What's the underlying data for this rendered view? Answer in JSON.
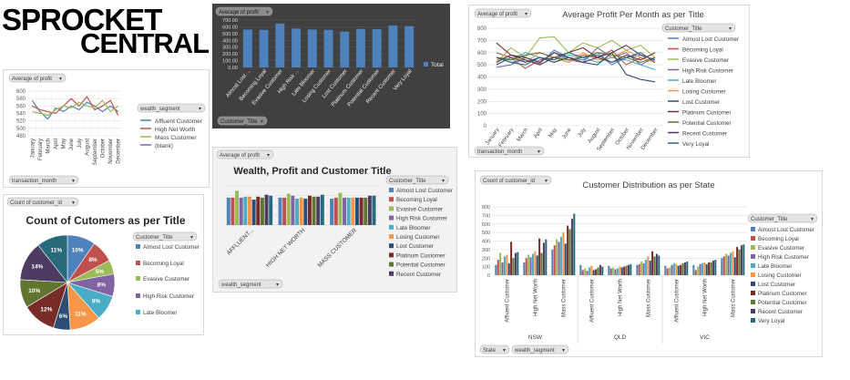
{
  "logo": {
    "line1": "SPROCKET",
    "line2": "CENTRAL"
  },
  "panels": {
    "profit_by_month": {
      "field_button": "Average of profit",
      "row_button": "transaction_month",
      "legend_button": "wealth_segment",
      "chart_data": {
        "type": "line",
        "ylim": [
          480,
          600
        ],
        "yticks": [
          "600",
          "580",
          "560",
          "540",
          "520",
          "500",
          "480"
        ],
        "categories": [
          "January",
          "February",
          "March",
          "April",
          "May",
          "June",
          "July",
          "August",
          "September",
          "October",
          "November",
          "December"
        ],
        "series": [
          {
            "name": "Affluent Customer",
            "color": "#4f81bd",
            "values": [
              575,
              545,
              525,
              555,
              545,
              560,
              550,
              570,
              560,
              545,
              560,
              545
            ]
          },
          {
            "name": "High Net Worth",
            "color": "#c0504d",
            "values": [
              560,
              550,
              545,
              540,
              560,
              580,
              560,
              585,
              550,
              560,
              575,
              535
            ]
          },
          {
            "name": "Mass Customer",
            "color": "#9bbb59",
            "values": [
              545,
              540,
              535,
              550,
              560,
              555,
              570,
              560,
              555,
              575,
              545,
              560
            ]
          },
          {
            "name": "(blank)",
            "color": "#8064a2",
            "values": []
          }
        ]
      }
    },
    "profit_by_title_dark": {
      "field_button": "Average of profit",
      "filter_button": "Customer_Title",
      "chart_data": {
        "type": "bar",
        "ylim": [
          0,
          700
        ],
        "yticks": [
          "700.00",
          "600.00",
          "500.00",
          "400.00",
          "300.00",
          "200.00",
          "100.00",
          "0.00"
        ],
        "categories": [
          "Almost Lost ...",
          "Becoming Loyal",
          "Evasive Customer",
          "High Risk ...",
          "Late Bloomer",
          "Losing Customer",
          "Lost Customer",
          "Platinum Customer",
          "Potential Customer",
          "Recent Customer",
          "Very Loyal"
        ],
        "series": [
          {
            "name": "Total",
            "color": "#4f81bd",
            "values": [
              560,
              555,
              650,
              575,
              560,
              555,
              530,
              570,
              565,
              620,
              610
            ]
          }
        ]
      }
    },
    "avg_profit_month_title": {
      "field_button": "Average of profit",
      "row_button": "transaction_month",
      "legend_button": "Customer_Title",
      "chart_data": {
        "type": "line",
        "title": "Average Profit Per Month as per Title",
        "ylim": [
          0,
          800
        ],
        "yticks": [
          "800",
          "700",
          "600",
          "500",
          "400",
          "300",
          "200",
          "100",
          "0"
        ],
        "categories": [
          "January",
          "February",
          "March",
          "April",
          "May",
          "June",
          "July",
          "August",
          "September",
          "October",
          "November",
          "December"
        ],
        "series": [
          {
            "name": "Almost Lost Customer",
            "color": "#4f81bd",
            "values": [
              560,
              520,
              540,
              510,
              620,
              560,
              540,
              600,
              500,
              560,
              580,
              540
            ]
          },
          {
            "name": "Becoming Loyal",
            "color": "#c0504d",
            "values": [
              600,
              560,
              470,
              540,
              560,
              520,
              580,
              560,
              620,
              500,
              560,
              520
            ]
          },
          {
            "name": "Evasive Customer",
            "color": "#9bbb59",
            "values": [
              520,
              640,
              560,
              720,
              730,
              600,
              680,
              640,
              700,
              620,
              660,
              560
            ]
          },
          {
            "name": "High Risk Customer",
            "color": "#8064a2",
            "values": [
              480,
              500,
              560,
              520,
              600,
              540,
              520,
              640,
              560,
              600,
              500,
              560
            ]
          },
          {
            "name": "Late Bloomer",
            "color": "#4bacc6",
            "values": [
              560,
              540,
              600,
              560,
              520,
              580,
              560,
              520,
              560,
              540,
              500,
              460
            ]
          },
          {
            "name": "Losing Customer",
            "color": "#f79646",
            "values": [
              540,
              580,
              520,
              600,
              560,
              520,
              600,
              540,
              560,
              620,
              560,
              520
            ]
          },
          {
            "name": "Lost Customer",
            "color": "#2c4d75",
            "values": [
              500,
              560,
              520,
              560,
              520,
              560,
              520,
              500,
              600,
              420,
              380,
              360
            ]
          },
          {
            "name": "Platinum Customer",
            "color": "#772c2a",
            "values": [
              680,
              580,
              540,
              500,
              560,
              600,
              640,
              560,
              520,
              580,
              540,
              600
            ]
          },
          {
            "name": "Potential Customer",
            "color": "#5f7530",
            "values": [
              560,
              540,
              580,
              600,
              560,
              540,
              560,
              600,
              580,
              560,
              520,
              560
            ]
          },
          {
            "name": "Recent Customer",
            "color": "#4d3b62",
            "values": [
              520,
              580,
              560,
              520,
              600,
              560,
              520,
              560,
              600,
              660,
              580,
              540
            ]
          },
          {
            "name": "Very Loyal",
            "color": "#276a7c",
            "values": [
              560,
              520,
              500,
              560,
              540,
              600,
              560,
              580,
              520,
              560,
              600,
              520
            ]
          }
        ]
      }
    },
    "wealth_profit_title": {
      "field_button": "Average of profit",
      "row_button": "wealth_segment",
      "legend_button": "Customer_Title",
      "chart_data": {
        "type": "bar",
        "title": "Wealth, Profit and Customer Title",
        "ylim": [
          0,
          800
        ],
        "categories": [
          "AFFLUENT...",
          "HIGH NET WORTH",
          "MASS CUSTOMER"
        ],
        "series": [
          {
            "name": "Almost Lost Customer",
            "color": "#4f81bd",
            "values": [
              560,
              560,
              540
            ]
          },
          {
            "name": "Becoming Loyal",
            "color": "#c0504d",
            "values": [
              560,
              560,
              560
            ]
          },
          {
            "name": "Evasive Customer",
            "color": "#9bbb59",
            "values": [
              700,
              640,
              660
            ]
          },
          {
            "name": "High Risk Customer",
            "color": "#8064a2",
            "values": [
              560,
              600,
              560
            ]
          },
          {
            "name": "Late Bloomer",
            "color": "#4bacc6",
            "values": [
              580,
              540,
              560
            ]
          },
          {
            "name": "Losing Customer",
            "color": "#f79646",
            "values": [
              580,
              560,
              560
            ]
          },
          {
            "name": "Lost Customer",
            "color": "#2c4d75",
            "values": [
              520,
              540,
              560
            ]
          },
          {
            "name": "Platinum Customer",
            "color": "#772c2a",
            "values": [
              580,
              600,
              560
            ]
          },
          {
            "name": "Potential Customer",
            "color": "#5f7530",
            "values": [
              560,
              580,
              560
            ]
          },
          {
            "name": "Recent Customer",
            "color": "#4d3b62",
            "values": [
              620,
              580,
              600
            ]
          },
          {
            "name": "Very Loyal",
            "color": "#276a7c",
            "values": [
              600,
              620,
              600
            ]
          }
        ]
      }
    },
    "customer_count_pie": {
      "field_button": "Count of customer_id",
      "legend_button": "Customer_Title",
      "chart_data": {
        "type": "pie",
        "title": "Count of Cutomers as per Title",
        "slices": [
          {
            "name": "Almost Lost Customer",
            "color": "#4f81bd",
            "value": 10,
            "label": "10%"
          },
          {
            "name": "Becoming Loyal",
            "color": "#c0504d",
            "value": 8,
            "label": "8%"
          },
          {
            "name": "Evasive Customer",
            "color": "#9bbb59",
            "value": 5,
            "label": "5%"
          },
          {
            "name": "High Risk Customer",
            "color": "#8064a2",
            "value": 8,
            "label": "8%"
          },
          {
            "name": "Late Bloomer",
            "color": "#4bacc6",
            "value": 9,
            "label": "9%"
          },
          {
            "name": "Losing Customer",
            "color": "#f79646",
            "value": 11,
            "label": "11%"
          },
          {
            "name": "Lost Customer",
            "color": "#2c4d75",
            "value": 6,
            "label": "6%"
          },
          {
            "name": "Platinum Customer",
            "color": "#772c2a",
            "value": 12,
            "label": "12%"
          },
          {
            "name": "Potential Customer",
            "color": "#5f7530",
            "value": 10,
            "label": "10%"
          },
          {
            "name": "Recent Customer",
            "color": "#4d3b62",
            "value": 14,
            "label": "14%"
          },
          {
            "name": "Very Loyal",
            "color": "#276a7c",
            "value": 11,
            "label": "11%"
          }
        ],
        "legend_visible": [
          "Almost Lost Customer",
          "Becoming Loyal",
          "Evasive Customer",
          "High Risk Customer",
          "Late Bloomer"
        ]
      }
    },
    "customer_distribution_state": {
      "field_button": "Count of customer_id",
      "legend_button": "Customer_Title",
      "row_buttons": [
        "State",
        "wealth_segment"
      ],
      "chart_data": {
        "type": "bar",
        "title": "Customer Distribution as per State",
        "ylim": [
          0,
          800
        ],
        "yticks": [
          "800",
          "700",
          "600",
          "500",
          "400",
          "300",
          "200",
          "100",
          "0"
        ],
        "states": [
          "NSW",
          "QLD",
          "VIC"
        ],
        "segments": [
          "Affluent Customer",
          "High Net Worth",
          "Mass Customer"
        ],
        "series": [
          {
            "name": "Almost Lost Customer",
            "color": "#4f81bd",
            "values": [
              120,
              150,
              300,
              120,
              110,
              120,
              110,
              120,
              200
            ]
          },
          {
            "name": "Becoming Loyal",
            "color": "#c0504d",
            "values": [
              180,
              200,
              350,
              60,
              80,
              130,
              80,
              60,
              220
            ]
          },
          {
            "name": "Evasive Customer",
            "color": "#9bbb59",
            "values": [
              260,
              240,
              420,
              80,
              90,
              160,
              90,
              100,
              250
            ]
          },
          {
            "name": "High Risk Customer",
            "color": "#8064a2",
            "values": [
              150,
              210,
              390,
              50,
              70,
              140,
              120,
              130,
              230
            ]
          },
          {
            "name": "Late Bloomer",
            "color": "#4bacc6",
            "values": [
              220,
              250,
              450,
              90,
              80,
              180,
              140,
              140,
              260
            ]
          },
          {
            "name": "Losing Customer",
            "color": "#f79646",
            "values": [
              240,
              280,
              500,
              110,
              100,
              220,
              130,
              150,
              280
            ]
          },
          {
            "name": "Lost Customer",
            "color": "#2c4d75",
            "values": [
              140,
              230,
              370,
              60,
              90,
              170,
              110,
              130,
              210
            ]
          },
          {
            "name": "Platinum Customer",
            "color": "#772c2a",
            "values": [
              390,
              430,
              580,
              70,
              100,
              280,
              120,
              150,
              330
            ]
          },
          {
            "name": "Potential Customer",
            "color": "#5f7530",
            "values": [
              200,
              260,
              540,
              90,
              110,
              220,
              140,
              150,
              300
            ]
          },
          {
            "name": "Recent Customer",
            "color": "#4d3b62",
            "values": [
              260,
              380,
              660,
              120,
              120,
              250,
              150,
              170,
              350
            ]
          },
          {
            "name": "Very Loyal",
            "color": "#276a7c",
            "values": [
              270,
              420,
              720,
              100,
              130,
              230,
              160,
              180,
              360
            ]
          }
        ]
      }
    }
  }
}
